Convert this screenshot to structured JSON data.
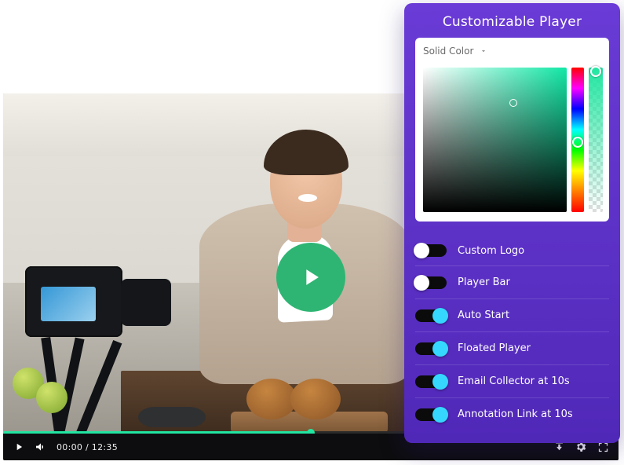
{
  "panel": {
    "title": "Customizable Player",
    "color_mode_label": "Solid Color",
    "toggles": [
      {
        "label": "Custom Logo",
        "on": false
      },
      {
        "label": "Player Bar",
        "on": false
      },
      {
        "label": "Auto Start",
        "on": true
      },
      {
        "label": "Floated Player",
        "on": true
      },
      {
        "label": "Email Collector at 10s",
        "on": true
      },
      {
        "label": "Annotation Link at 10s",
        "on": true
      }
    ]
  },
  "player": {
    "progress_percent": 50,
    "current_time": "00:00",
    "duration": "12:35",
    "time_display": "00:00 / 12:35"
  },
  "colors": {
    "accent": "#21e6a1",
    "panel_bg": "#5a2fc6",
    "toggle_on": "#35d7ff",
    "bigplay": "#2fb573"
  }
}
